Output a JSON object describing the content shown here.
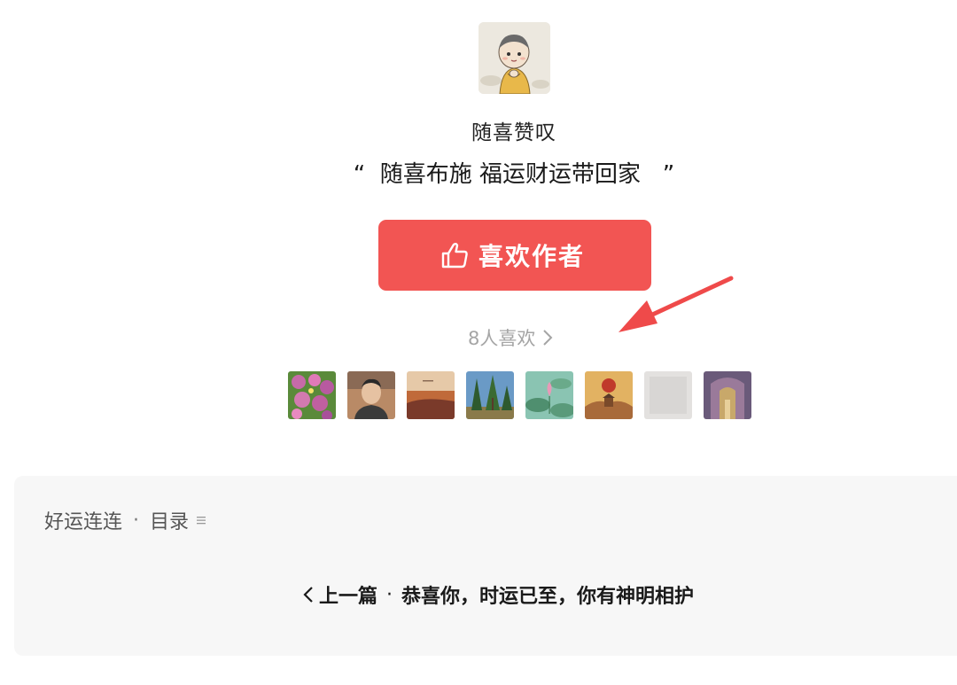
{
  "author": {
    "name": "随喜赞叹",
    "avatar_icon": "monk-cartoon-avatar"
  },
  "reward": {
    "quote_open": "“",
    "quote_text": "随喜布施 福运财运带回家",
    "quote_close": "”",
    "like_button_label": "喜欢作者",
    "like_icon": "thumbs-up-icon",
    "likes_count_label": "8人喜欢",
    "accent_color": "#f25553"
  },
  "likers": [
    {
      "name": "flowers-avatar",
      "colors": [
        "#c76aa8",
        "#6aa84f"
      ]
    },
    {
      "name": "man-selfie-avatar",
      "colors": [
        "#8a6a55",
        "#3b3b3b"
      ]
    },
    {
      "name": "sunset-landscape-avatar",
      "colors": [
        "#c06a3a",
        "#7a3a2a"
      ]
    },
    {
      "name": "trees-sky-avatar",
      "colors": [
        "#4a7fb0",
        "#2e5a2e"
      ]
    },
    {
      "name": "lotus-avatar",
      "colors": [
        "#7fb7a5",
        "#d98aa8"
      ]
    },
    {
      "name": "red-sun-temple-avatar",
      "colors": [
        "#d8a24a",
        "#c0392b"
      ]
    },
    {
      "name": "blank-gray-avatar",
      "colors": [
        "#dcdcdc",
        "#e8e8e8"
      ]
    },
    {
      "name": "corridor-avatar",
      "colors": [
        "#7a6a8a",
        "#b89a6a"
      ]
    }
  ],
  "collection": {
    "title": "好运连连",
    "separator": "·",
    "toc_label": "目录",
    "menu_icon": "list-icon"
  },
  "navigation": {
    "prev_label": "上一篇",
    "separator": "·",
    "prev_title": "恭喜你，时运已至，你有神明相护"
  }
}
